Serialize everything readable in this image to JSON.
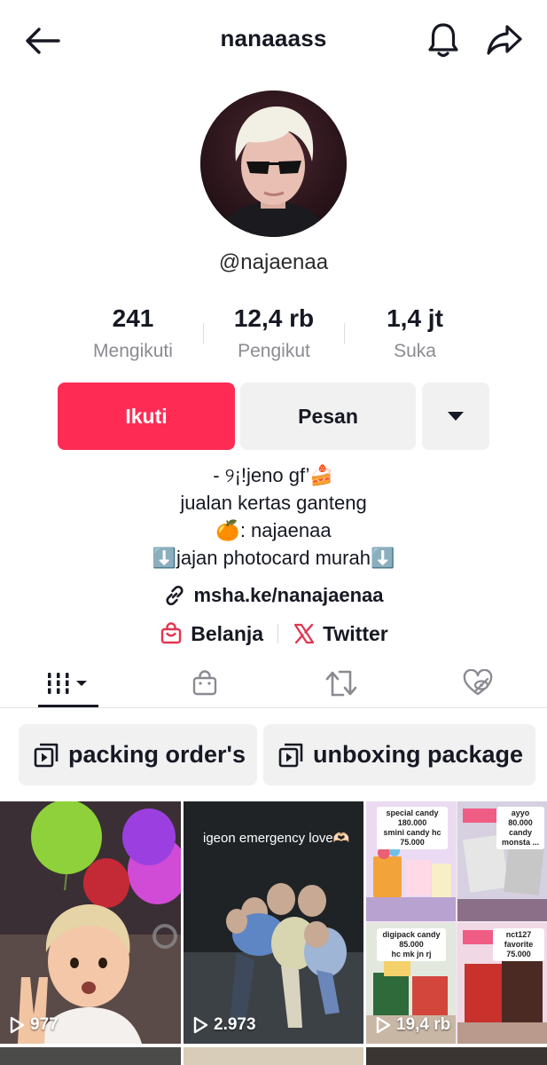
{
  "header": {
    "title": "nanaaass",
    "back_icon": "arrow-left-icon",
    "bell_icon": "bell-icon",
    "share_icon": "share-arrow-icon"
  },
  "profile": {
    "handle": "@najaenaa",
    "stats": [
      {
        "value": "241",
        "label": "Mengikuti"
      },
      {
        "value": "12,4 rb",
        "label": "Pengikut"
      },
      {
        "value": "1,4 jt",
        "label": "Suka"
      }
    ],
    "follow_label": "Ikuti",
    "message_label": "Pesan",
    "bio_lines": [
      "- ୨¡!jeno gf’🍰",
      "jualan kertas ganteng",
      "🍊: najaenaa",
      "⬇️jajan photocard murah⬇️"
    ],
    "link": "msha.ke/nanajaenaa",
    "shop_label": "Belanja",
    "twitter_label": "Twitter"
  },
  "tabs": [
    "videos-grid",
    "shop",
    "reposts",
    "liked-private"
  ],
  "playlists": [
    {
      "label": "packing order's"
    },
    {
      "label": "unboxing package"
    }
  ],
  "videos": [
    {
      "views": "977"
    },
    {
      "views": "2.973",
      "caption": "igeon emergency love🫶🏻"
    },
    {
      "views": "19,4 rb",
      "panels": [
        "special candy\n180.000\nsmini candy hc\n75.000",
        "ayyo 80.000\ncandy\nmonsta ...",
        "digipack candy\n85.000\nhc mk jn rj",
        "nct127 favorite\n75.000"
      ]
    }
  ],
  "colors": {
    "accent": "#fe2c55",
    "button_gray": "#f1f1f2",
    "text": "#161823",
    "muted": "#8a8b91",
    "twitter_red": "#e0364f"
  }
}
